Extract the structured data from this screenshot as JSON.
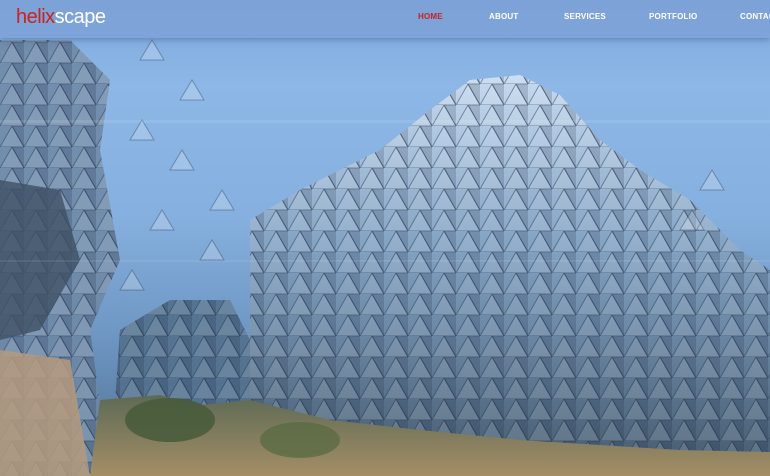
{
  "brand": {
    "logo_part_a": "helix",
    "logo_part_b": "scape",
    "accent_color": "#c8231f"
  },
  "nav": {
    "items": [
      {
        "label": "HOME",
        "active": true
      },
      {
        "label": "ABOUT",
        "active": false
      },
      {
        "label": "SERVICES",
        "active": false
      },
      {
        "label": "PORTFOLIO",
        "active": false
      },
      {
        "label": "CONTACT",
        "active": false
      }
    ]
  },
  "hero": {
    "image_subject": "triangulated-glass-building-image"
  }
}
